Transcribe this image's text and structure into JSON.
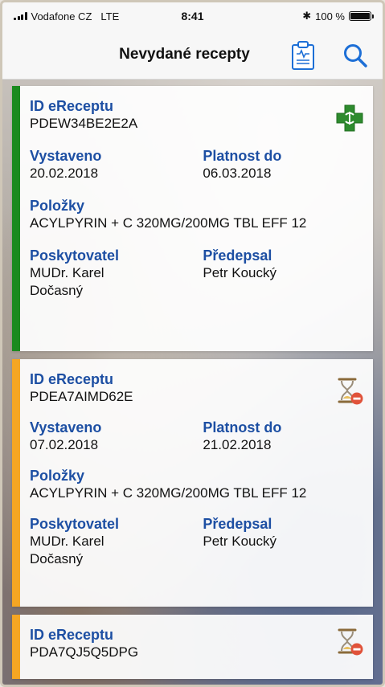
{
  "statusbar": {
    "carrier": "Vodafone CZ",
    "network": "LTE",
    "time": "8:41",
    "bluetooth": "✱",
    "battery_text": "100 %"
  },
  "navbar": {
    "title": "Nevydané recepty",
    "clipboard_icon": "clipboard-icon",
    "search_icon": "search-icon"
  },
  "labels": {
    "id": "ID eReceptu",
    "issued": "Vystaveno",
    "valid_until": "Platnost do",
    "items": "Položky",
    "provider": "Poskytovatel",
    "prescriber": "Předepsal"
  },
  "colors": {
    "accent_blue": "#1d4fa3",
    "active_green": "#1a8a1f",
    "pending_orange": "#f5a623"
  },
  "cards": [
    {
      "status": "active",
      "status_icon": "pharmacy-cross-icon",
      "id": "PDEW34BE2E2A",
      "issued": "20.02.2018",
      "valid_until": "06.03.2018",
      "items": "ACYLPYRIN + C 320MG/200MG TBL EFF 12",
      "provider_line1": "MUDr. Karel",
      "provider_line2": "Dočasný",
      "prescriber": "Petr Koucký"
    },
    {
      "status": "pending",
      "status_icon": "hourglass-cancel-icon",
      "id": "PDEA7AIMD62E",
      "issued": "07.02.2018",
      "valid_until": "21.02.2018",
      "items": "ACYLPYRIN + C 320MG/200MG TBL EFF 12",
      "provider_line1": "MUDr. Karel",
      "provider_line2": "Dočasný",
      "prescriber": "Petr Koucký"
    },
    {
      "status": "pending",
      "status_icon": "hourglass-cancel-icon",
      "id": "PDA7QJ5Q5DPG"
    }
  ]
}
